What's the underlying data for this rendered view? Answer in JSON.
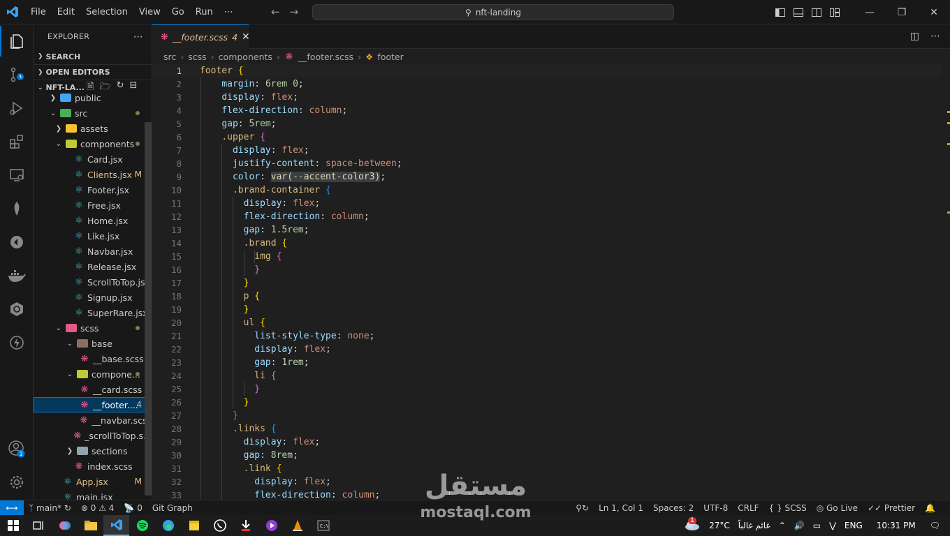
{
  "menu": [
    "File",
    "Edit",
    "Selection",
    "View",
    "Go",
    "Run",
    "⋯"
  ],
  "command_center": {
    "text": "nft-landing"
  },
  "sidebar": {
    "header": "EXPLORER",
    "sections": [
      "SEARCH",
      "OPEN EDITORS"
    ],
    "project": "NFT-LA...",
    "tree": [
      {
        "label": "public",
        "type": "folder",
        "depth": 1,
        "open": false,
        "color": "#42a5f5"
      },
      {
        "label": "src",
        "type": "folder",
        "depth": 1,
        "open": true,
        "color": "#4caf50",
        "dot": true
      },
      {
        "label": "assets",
        "type": "folder",
        "depth": 2,
        "open": false,
        "color": "#fbc02d"
      },
      {
        "label": "components",
        "type": "folder",
        "depth": 2,
        "open": true,
        "color": "#c0ca33",
        "dot": true
      },
      {
        "label": "Card.jsx",
        "type": "react",
        "depth": 3
      },
      {
        "label": "Clients.jsx",
        "type": "react",
        "depth": 3,
        "badge": "M"
      },
      {
        "label": "Footer.jsx",
        "type": "react",
        "depth": 3
      },
      {
        "label": "Free.jsx",
        "type": "react",
        "depth": 3
      },
      {
        "label": "Home.jsx",
        "type": "react",
        "depth": 3
      },
      {
        "label": "Like.jsx",
        "type": "react",
        "depth": 3
      },
      {
        "label": "Navbar.jsx",
        "type": "react",
        "depth": 3
      },
      {
        "label": "Release.jsx",
        "type": "react",
        "depth": 3
      },
      {
        "label": "ScrollToTop.jsx",
        "type": "react",
        "depth": 3
      },
      {
        "label": "Signup.jsx",
        "type": "react",
        "depth": 3
      },
      {
        "label": "SuperRare.jsx",
        "type": "react",
        "depth": 3
      },
      {
        "label": "scss",
        "type": "folder",
        "depth": 2,
        "open": true,
        "color": "#e0598a",
        "dot": true
      },
      {
        "label": "base",
        "type": "folder",
        "depth": 3,
        "open": true,
        "color": "#8d6e63"
      },
      {
        "label": "__base.scss",
        "type": "scss",
        "depth": 4
      },
      {
        "label": "compone...",
        "type": "folder",
        "depth": 3,
        "open": true,
        "color": "#c0ca33",
        "dot": true
      },
      {
        "label": "__card.scss",
        "type": "scss",
        "depth": 4
      },
      {
        "label": "__footer....",
        "type": "scss",
        "depth": 4,
        "badge": "4",
        "selected": true
      },
      {
        "label": "__navbar.scss",
        "type": "scss",
        "depth": 4
      },
      {
        "label": "_scrollToTop.s...",
        "type": "scss",
        "depth": 4
      },
      {
        "label": "sections",
        "type": "folder",
        "depth": 3,
        "open": false,
        "color": "#90a4ae"
      },
      {
        "label": "index.scss",
        "type": "scss",
        "depth": 3
      },
      {
        "label": "App.jsx",
        "type": "react",
        "depth": 2,
        "badge": "M"
      },
      {
        "label": "main.jsx",
        "type": "react",
        "depth": 2
      }
    ]
  },
  "tab": {
    "label": "__footer.scss",
    "problems": "4"
  },
  "breadcrumb": [
    "src",
    "scss",
    "components",
    "__footer.scss",
    "footer"
  ],
  "code_lines": [
    "footer {",
    "    margin: 6rem 0;",
    "    display: flex;",
    "    flex-direction: column;",
    "    gap: 5rem;",
    "    .upper {",
    "      display: flex;",
    "      justify-content: space-between;",
    "      color: var(--accent-color3);",
    "      .brand-container {",
    "        display: flex;",
    "        flex-direction: column;",
    "        gap: 1.5rem;",
    "        .brand {",
    "          img {",
    "          }",
    "        }",
    "        p {",
    "        }",
    "        ul {",
    "          list-style-type: none;",
    "          display: flex;",
    "          gap: 1rem;",
    "          li {",
    "          }",
    "        }",
    "      }",
    "      .links {",
    "        display: flex;",
    "        gap: 8rem;",
    "        .link {",
    "          display: flex;",
    "          flex-direction: column;"
  ],
  "status": {
    "branch": "main*",
    "errors": "0",
    "warnings": "4",
    "ports": "0",
    "git_graph": "Git Graph",
    "position": "Ln 1, Col 1",
    "spaces": "Spaces: 2",
    "encoding": "UTF-8",
    "eol": "CRLF",
    "language": "SCSS",
    "golive": "Go Live",
    "prettier": "Prettier"
  },
  "taskbar": {
    "weather": "27°C",
    "weather_text": "غائم غالباً",
    "lang": "ENG",
    "time": "10:31 PM",
    "notif_count": "1"
  },
  "account_badge": "1",
  "watermark": {
    "arabic": "مستقل",
    "latin": "mostaql.com"
  },
  "colors": {
    "accent": "#0078d4",
    "modified": "#e2c08d"
  }
}
